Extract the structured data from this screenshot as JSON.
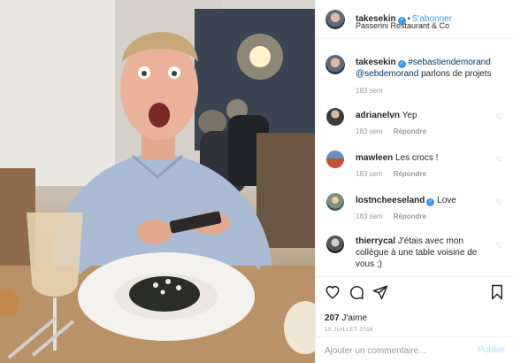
{
  "post": {
    "author": "takesekin",
    "follow_label": "S'abonner",
    "location": "Passerini Restaurant & Co",
    "caption": {
      "author": "takesekin",
      "mention1": "#sebastiendemorand",
      "mention2": "@sebdemorand",
      "text": " parlons de projets",
      "age": "183 sem"
    }
  },
  "comments": [
    {
      "author": "adrianelvn",
      "verified": false,
      "text": "Yep",
      "age": "183 sem",
      "reply": "Répondre"
    },
    {
      "author": "mawleen",
      "verified": false,
      "text": "Les crocs !",
      "age": "183 sem",
      "reply": "Répondre"
    },
    {
      "author": "lostncheeseland",
      "verified": true,
      "text": "Love",
      "age": "183 sem",
      "reply": "Répondre"
    },
    {
      "author": "thierrycal",
      "verified": false,
      "text": "J'étais avec mon collègue à une table voisine de vous ;)",
      "age": "",
      "reply": ""
    }
  ],
  "actions": {
    "likes_count": "207",
    "likes_label": " J'aime",
    "date": "15 JUILLET 2016"
  },
  "comment_box": {
    "placeholder": "Ajouter un commentaire...",
    "publish_label": "Publier"
  },
  "icons": {
    "verified": "verified-badge-icon",
    "heart": "heart-icon",
    "comment": "comment-bubble-icon",
    "share": "paper-plane-icon",
    "bookmark": "bookmark-icon"
  },
  "colors": {
    "link_blue": "#3897f0",
    "muted": "#999999",
    "text": "#262626"
  }
}
